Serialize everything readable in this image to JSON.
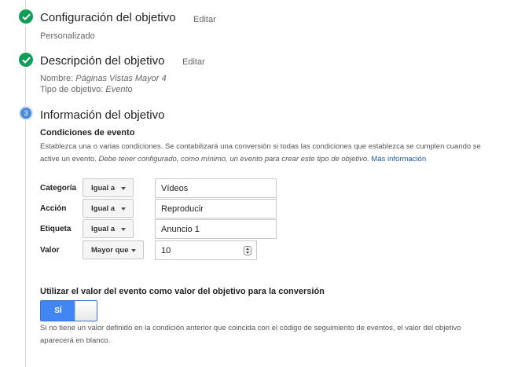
{
  "steps": [
    {
      "title": "Configuración del objetivo",
      "edit_label": "Editar",
      "summary": "Personalizado"
    },
    {
      "title": "Descripción del objetivo",
      "edit_label": "Editar",
      "name_label": "Nombre:",
      "name_value": "Páginas Vistas Mayor 4",
      "type_label": "Tipo de objetivo:",
      "type_value": "Evento"
    },
    {
      "number": "3",
      "title": "Información del objetivo"
    }
  ],
  "conditions": {
    "title": "Condiciones de evento",
    "description_plain": "Establezca una o varias condiciones. Se contabilizará una conversión si todas las condiciones que establezca se cumplen cuando se active un evento.",
    "description_italic": "Debe tener configurado, como mínimo, un evento para crear este tipo de objetivo.",
    "more_info_link": "Más información",
    "rows": [
      {
        "label": "Categoría",
        "operator": "Igual a",
        "value": "Vídeos"
      },
      {
        "label": "Acción",
        "operator": "Igual a",
        "value": "Reproducir"
      },
      {
        "label": "Etiqueta",
        "operator": "Igual a",
        "value": "Anuncio 1"
      },
      {
        "label": "Valor",
        "operator": "Mayor que",
        "value": "10"
      }
    ]
  },
  "use_value": {
    "title": "Utilizar el valor del evento como valor del objetivo para la conversión",
    "toggle_label": "SÍ",
    "toggle_on": true,
    "note": "Si no tiene un valor definido en la condición anterior que coincida con el código de seguimiento de eventos, el valor del objetivo aparecerá en blanco."
  },
  "colors": {
    "check_green": "#0f9d58",
    "step_blue": "#4a8ad8",
    "link_blue": "#1a5fb4",
    "toggle_blue": "#4285f4"
  },
  "icons": {
    "step_done": "check-icon",
    "dropdown": "caret-down-icon",
    "number_spinner": "spinner-icon"
  }
}
